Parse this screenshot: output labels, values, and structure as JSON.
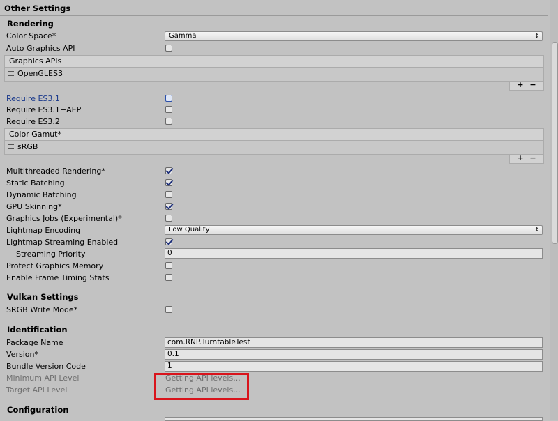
{
  "header": {
    "title": "Other Settings"
  },
  "rendering": {
    "section_title": "Rendering",
    "color_space": {
      "label": "Color Space*",
      "value": "Gamma",
      "arrow": "↕"
    },
    "auto_graphics_api": {
      "label": "Auto Graphics API",
      "checked": false
    },
    "graphics_apis": {
      "header": "Graphics APIs",
      "items": [
        "OpenGLES3"
      ],
      "add": "+",
      "remove": "−"
    },
    "require_es31": {
      "label": "Require ES3.1",
      "checked": false
    },
    "require_es31_aep": {
      "label": "Require ES3.1+AEP",
      "checked": false
    },
    "require_es32": {
      "label": "Require ES3.2",
      "checked": false
    },
    "color_gamut": {
      "header": "Color Gamut*",
      "items": [
        "sRGB"
      ],
      "add": "+",
      "remove": "−"
    },
    "multithreaded": {
      "label": "Multithreaded Rendering*",
      "checked": true
    },
    "static_batching": {
      "label": "Static Batching",
      "checked": true
    },
    "dynamic_batching": {
      "label": "Dynamic Batching",
      "checked": false
    },
    "gpu_skinning": {
      "label": "GPU Skinning*",
      "checked": true
    },
    "graphics_jobs": {
      "label": "Graphics Jobs (Experimental)*",
      "checked": false
    },
    "lightmap_encoding": {
      "label": "Lightmap Encoding",
      "value": "Low Quality",
      "arrow": "↕"
    },
    "lightmap_streaming": {
      "label": "Lightmap Streaming Enabled",
      "checked": true
    },
    "streaming_priority": {
      "label": "Streaming Priority",
      "value": "0"
    },
    "protect_memory": {
      "label": "Protect Graphics Memory",
      "checked": false
    },
    "frame_timing": {
      "label": "Enable Frame Timing Stats",
      "checked": false
    }
  },
  "vulkan": {
    "section_title": "Vulkan Settings",
    "srgb_write": {
      "label": "SRGB Write Mode*",
      "checked": false
    }
  },
  "identification": {
    "section_title": "Identification",
    "package_name": {
      "label": "Package Name",
      "value": "com.RNP.TurntableTest"
    },
    "version": {
      "label": "Version*",
      "value": "0.1"
    },
    "bundle_version_code": {
      "label": "Bundle Version Code",
      "value": "1"
    },
    "min_api_level": {
      "label": "Minimum API Level",
      "value": "Getting API levels..."
    },
    "target_api_level": {
      "label": "Target API Level",
      "value": "Getting API levels..."
    }
  },
  "configuration": {
    "section_title": "Configuration"
  },
  "highlight_color": "#d9141c"
}
